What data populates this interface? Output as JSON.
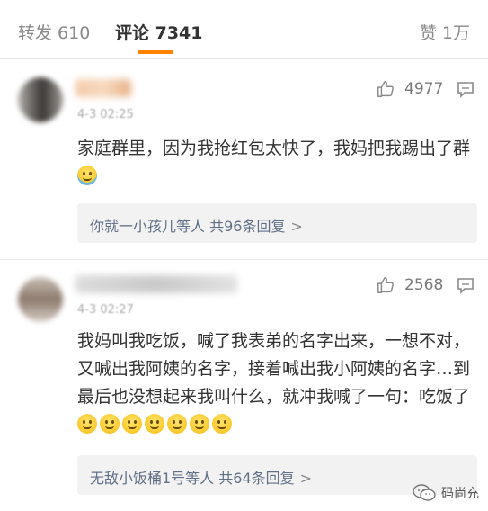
{
  "tabs": {
    "repost": "转发 610",
    "comments": "评论 7341",
    "likes": "赞 1万"
  },
  "comments": [
    {
      "time": "4-3 02:25",
      "like_count": "4977",
      "text": "家庭群里，因为我抢红包太快了，我妈把我踢出了群",
      "reply_summary": "你就一小孩儿等人 共96条回复",
      "reply_chevron": ">"
    },
    {
      "time": "4-3 02:27",
      "like_count": "2568",
      "text": "我妈叫我吃饭，喊了我表弟的名字出来，一想不对，又喊出我阿姨的名字，接着喊出我小阿姨的名字…到最后也没想起来我叫什么，就冲我喊了一句：吃饭了",
      "emoji_count": 7,
      "reply_summary": "无敌小饭桶1号等人 共64条回复",
      "reply_chevron": ">"
    }
  ],
  "watermark": "码尚充",
  "colors": {
    "accent": "#ff8200",
    "link": "#5f6f86",
    "reply_bg": "#f2f2f2"
  }
}
